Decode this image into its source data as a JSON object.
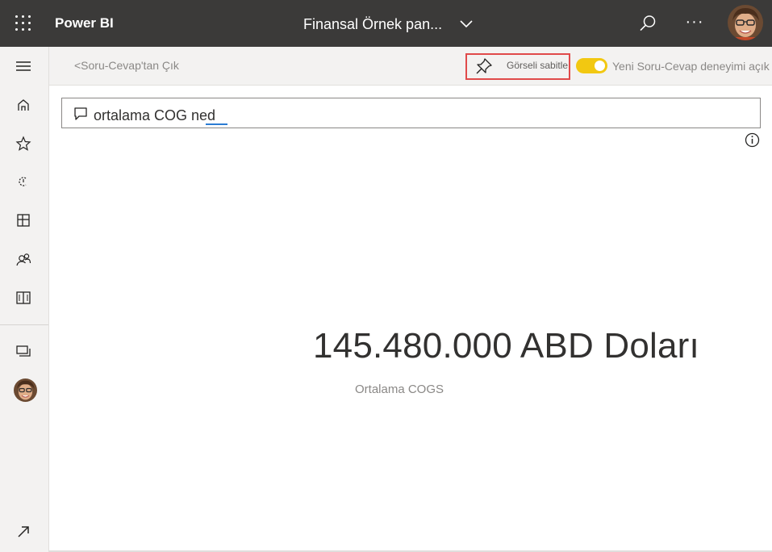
{
  "app": {
    "brand": "Power BI",
    "report_title": "Finansal Örnek pan...",
    "more_label": "···"
  },
  "icons": {
    "waffle": "app-launcher-icon",
    "chevron": "chevron-down-icon",
    "search": "search-icon",
    "more": "more-options-icon",
    "avatar": "user-avatar",
    "nav": [
      "hamburger-icon",
      "home-icon",
      "star-icon",
      "recent-icon",
      "apps-icon",
      "shared-icon",
      "learn-icon",
      "workspaces-icon",
      "expand-icon"
    ],
    "pin": "pin-icon",
    "comment": "comment-icon",
    "info": "info-icon"
  },
  "toolbar": {
    "exit_label": "<Soru-Cevap'tan Çık",
    "pin_label": "Görseli sabitle",
    "new_experience_label": "Yeni Soru-Cevap deneyimi açık",
    "toggle_on": true
  },
  "qa": {
    "query": "ortalama COG ned"
  },
  "result": {
    "value": "145.480.000 ABD Doları",
    "caption": "Ortalama COGS"
  },
  "colors": {
    "topbar": "#3b3a39",
    "toggle": "#f2c811",
    "highlight_box": "#e04a4a",
    "spell_underline": "#2b7cd3"
  }
}
